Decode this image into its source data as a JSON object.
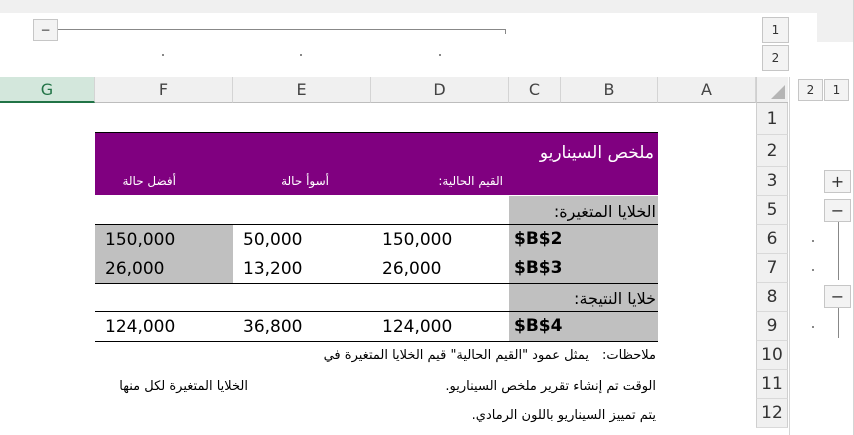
{
  "outline": {
    "collapse_button": "−",
    "col_levels": [
      "1",
      "2"
    ],
    "row_levels": [
      "1",
      "2"
    ],
    "expand_button": "+",
    "row_collapse_buttons": [
      "−",
      "−"
    ]
  },
  "columns": [
    "A",
    "B",
    "C",
    "D",
    "E",
    "F",
    "G"
  ],
  "rows": [
    "1",
    "2",
    "3",
    "5",
    "6",
    "7",
    "8",
    "9",
    "10",
    "11",
    "12"
  ],
  "scenario": {
    "title": "ملخص السيناريو",
    "headers": {
      "current": "القيم الحالية:",
      "worst": "أسوأ حالة",
      "best": "أفضل حالة"
    },
    "changing_cells_label": "الخلايا المتغيرة:",
    "changing_rows": [
      {
        "ref": "$B$2",
        "current": "150,000",
        "worst": "50,000",
        "best": "150,000"
      },
      {
        "ref": "$B$3",
        "current": "26,000",
        "worst": "13,200",
        "best": "26,000"
      }
    ],
    "result_cells_label": "خلايا النتيجة:",
    "result_rows": [
      {
        "ref": "$B$4",
        "current": "124,000",
        "worst": "36,800",
        "best": "124,000"
      }
    ]
  },
  "notes": {
    "label": "ملاحظات:",
    "line1": "يمثل عمود \"القيم الحالية\" قيم الخلايا المتغيرة في",
    "line2_right": "الوقت تم إنشاء تقرير ملخص السيناريو.",
    "line2_left": "الخلايا المتغيرة لكل منها",
    "line3": "يتم تمييز السيناريو باللون الرمادي."
  },
  "colors": {
    "header_purple": "#800080",
    "scenario_gray": "#c0c0c0",
    "selected_column": "#217346"
  }
}
